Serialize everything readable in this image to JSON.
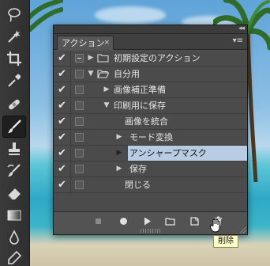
{
  "panel": {
    "tab_label": "アクション",
    "tab_close_glyph": "×",
    "menu_glyph": "▾≡",
    "collapse_glyph": "◂◂"
  },
  "actions": [
    {
      "label": "初期設定のアクション",
      "checked": true,
      "dialog": "on",
      "level": 0,
      "expander": "closed",
      "folder": true,
      "selected": false
    },
    {
      "label": "自分用",
      "checked": true,
      "dialog": "off",
      "level": 0,
      "expander": "open",
      "folder": true,
      "selected": false
    },
    {
      "label": "画像補正準備",
      "checked": true,
      "dialog": "off",
      "level": 1,
      "expander": "closed",
      "folder": false,
      "selected": false
    },
    {
      "label": "印刷用に保存",
      "checked": true,
      "dialog": "off",
      "level": 1,
      "expander": "open",
      "folder": false,
      "selected": false
    },
    {
      "label": "画像を統合",
      "checked": true,
      "dialog": "off",
      "level": 2,
      "expander": "none",
      "folder": false,
      "selected": false
    },
    {
      "label": "モード変換",
      "checked": true,
      "dialog": "off",
      "level": 2,
      "expander": "closed",
      "folder": false,
      "selected": false
    },
    {
      "label": "アンシャープマスク",
      "checked": true,
      "dialog": "off",
      "level": 2,
      "expander": "closed",
      "folder": false,
      "selected": true
    },
    {
      "label": "保存",
      "checked": true,
      "dialog": "off",
      "level": 2,
      "expander": "closed",
      "folder": false,
      "selected": false
    },
    {
      "label": "閉じる",
      "checked": true,
      "dialog": "off",
      "level": 2,
      "expander": "none",
      "folder": false,
      "selected": false
    }
  ],
  "check_glyph": "✔",
  "bottom_buttons": [
    "stop-icon",
    "record-icon",
    "play-icon",
    "new-set-icon",
    "new-action-icon",
    "delete-icon"
  ],
  "tooltip": {
    "text": "削除"
  },
  "colors": {
    "selection": "#b8cde4",
    "panel": "#535353",
    "tooltip_bg": "#ffffc5"
  }
}
